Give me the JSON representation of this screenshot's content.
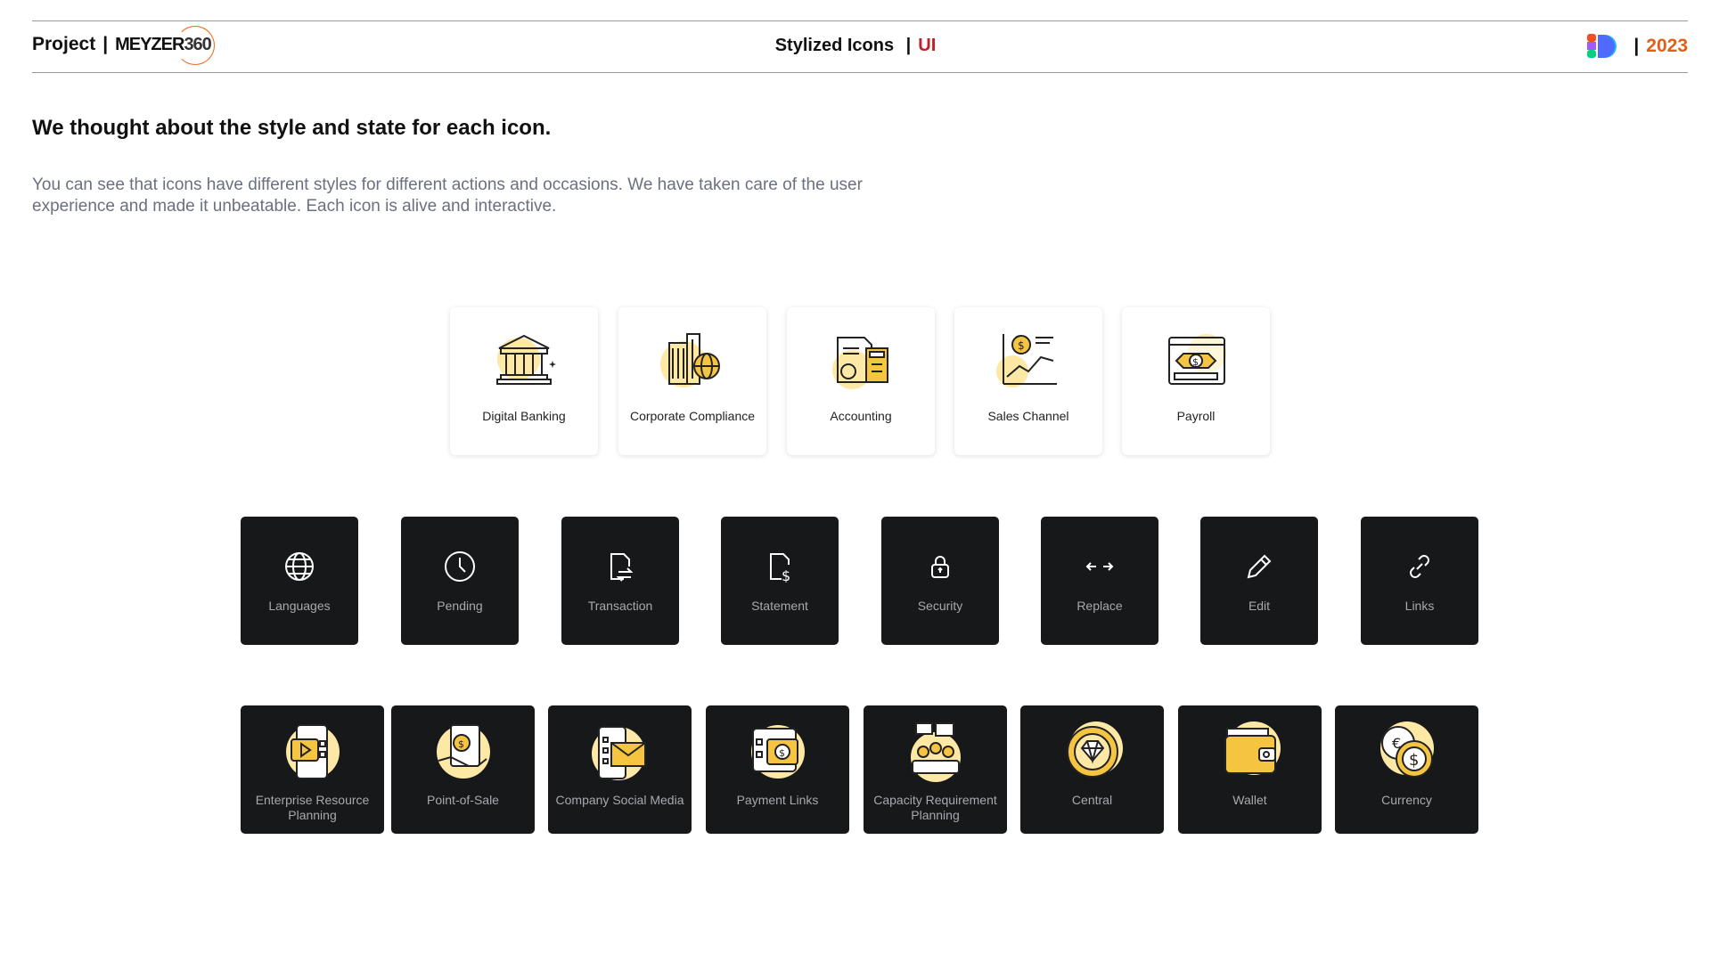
{
  "header": {
    "project_label": "Project",
    "separator": "|",
    "brand_name": "MEYZER",
    "brand_number": "360",
    "title": "Stylized Icons",
    "title_accent": "UI",
    "year": "2023"
  },
  "intro": {
    "headline": "We thought about the style and state for each icon.",
    "description": "You can see that icons have different styles for different actions and occasions. We have taken care of the user experience and made it unbeatable. Each icon is alive and interactive."
  },
  "colors": {
    "accent_yellow": "#f5c542",
    "accent_red": "#c0202a",
    "accent_orange": "#e0601a",
    "dark_card": "#17181a",
    "muted_text": "#6b7080"
  },
  "light_cards": [
    {
      "label": "Digital Banking",
      "icon": "bank-icon"
    },
    {
      "label": "Corporate Compliance",
      "icon": "building-globe-icon"
    },
    {
      "label": "Accounting",
      "icon": "calculator-document-icon"
    },
    {
      "label": "Sales Channel",
      "icon": "sales-chart-icon"
    },
    {
      "label": "Payroll",
      "icon": "payroll-browser-icon"
    }
  ],
  "dark_cards": [
    {
      "label": "Languages",
      "icon": "globe-icon"
    },
    {
      "label": "Pending",
      "icon": "clock-icon"
    },
    {
      "label": "Transaction",
      "icon": "file-transfer-icon"
    },
    {
      "label": "Statement",
      "icon": "file-dollar-icon"
    },
    {
      "label": "Security",
      "icon": "lock-icon"
    },
    {
      "label": "Replace",
      "icon": "arrows-horizontal-icon"
    },
    {
      "label": "Edit",
      "icon": "pencil-icon"
    },
    {
      "label": "Links",
      "icon": "link-icon"
    }
  ],
  "big_cards": [
    {
      "label": "Enterprise Resource Planning",
      "icon": "erp-phone-icon"
    },
    {
      "label": "Point-of-Sale",
      "icon": "pos-hand-coin-icon"
    },
    {
      "label": "Company Social Media",
      "icon": "social-mail-icon"
    },
    {
      "label": "Payment Links",
      "icon": "payment-link-icon"
    },
    {
      "label": "Capacity Requirement Planning",
      "icon": "team-chat-icon"
    },
    {
      "label": "Central",
      "icon": "diamond-badge-icon"
    },
    {
      "label": "Wallet",
      "icon": "wallet-icon"
    },
    {
      "label": "Currency",
      "icon": "coins-icon"
    }
  ]
}
